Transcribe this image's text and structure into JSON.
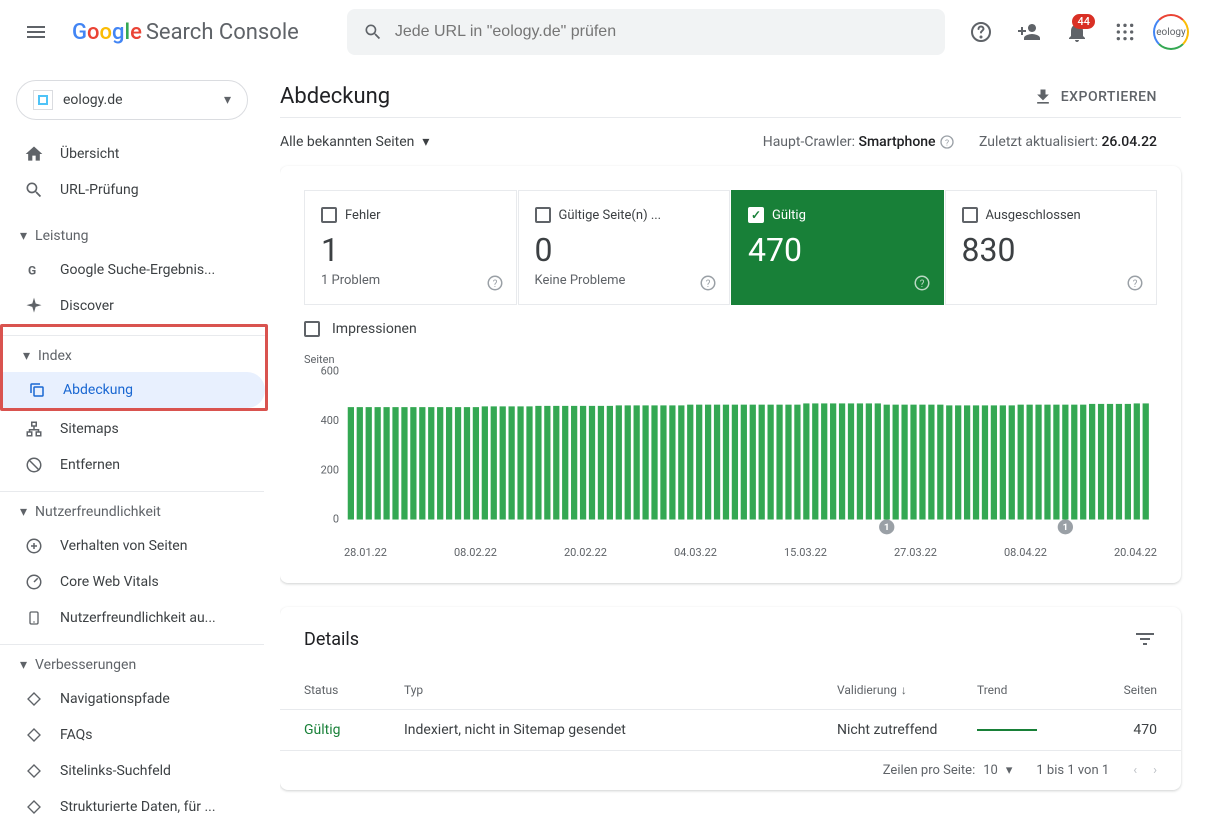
{
  "header": {
    "logo_text": "Search Console",
    "search_placeholder": "Jede URL in \"eology.de\" prüfen",
    "notification_count": "44"
  },
  "property": {
    "name": "eology.de"
  },
  "sidebar": {
    "overview": "Übersicht",
    "url_inspection": "URL-Prüfung",
    "section_performance": "Leistung",
    "search_results": "Google Suche-Ergebnis...",
    "discover": "Discover",
    "section_index": "Index",
    "coverage": "Abdeckung",
    "sitemaps": "Sitemaps",
    "removals": "Entfernen",
    "section_ux": "Nutzerfreundlichkeit",
    "page_experience": "Verhalten von Seiten",
    "core_web_vitals": "Core Web Vitals",
    "mobile_usability": "Nutzerfreundlichkeit au...",
    "section_enhancements": "Verbesserungen",
    "breadcrumbs": "Navigationspfade",
    "faqs": "FAQs",
    "sitelinks": "Sitelinks-Suchfeld",
    "structured_data": "Strukturierte Daten, für ..."
  },
  "page": {
    "title": "Abdeckung",
    "export": "EXPORTIEREN",
    "filter_label": "Alle bekannten Seiten",
    "crawler_label": "Haupt-Crawler:",
    "crawler_value": "Smartphone",
    "updated_label": "Zuletzt aktualisiert:",
    "updated_value": "26.04.22"
  },
  "status_tabs": {
    "error": {
      "label": "Fehler",
      "value": "1",
      "sub": "1 Problem"
    },
    "valid_warning": {
      "label": "Gültige Seite(n) ...",
      "value": "0",
      "sub": "Keine Probleme"
    },
    "valid": {
      "label": "Gültig",
      "value": "470"
    },
    "excluded": {
      "label": "Ausgeschlossen",
      "value": "830"
    }
  },
  "impressions_label": "Impressionen",
  "chart_data": {
    "type": "bar",
    "y_title": "Seiten",
    "ylim": [
      0,
      600
    ],
    "y_ticks": [
      "600",
      "400",
      "200",
      "0"
    ],
    "x_ticks": [
      "28.01.22",
      "08.02.22",
      "20.02.22",
      "04.03.22",
      "15.03.22",
      "27.03.22",
      "08.04.22",
      "20.04.22"
    ],
    "values": [
      455,
      455,
      455,
      455,
      455,
      455,
      455,
      455,
      455,
      455,
      455,
      455,
      455,
      455,
      455,
      458,
      458,
      458,
      458,
      458,
      458,
      460,
      460,
      460,
      460,
      460,
      460,
      460,
      460,
      460,
      462,
      462,
      462,
      462,
      462,
      462,
      462,
      462,
      465,
      465,
      465,
      465,
      465,
      465,
      465,
      465,
      465,
      465,
      465,
      465,
      465,
      470,
      470,
      470,
      470,
      470,
      470,
      470,
      470,
      470,
      465,
      465,
      465,
      465,
      465,
      465,
      465,
      462,
      462,
      462,
      462,
      462,
      462,
      462,
      462,
      465,
      465,
      465,
      465,
      465,
      465,
      465,
      465,
      468,
      468,
      468,
      468,
      468,
      470,
      470
    ],
    "markers": [
      {
        "index": 60,
        "label": "1"
      },
      {
        "index": 80,
        "label": "1"
      }
    ]
  },
  "details": {
    "title": "Details",
    "columns": {
      "status": "Status",
      "type": "Typ",
      "validation": "Validierung",
      "trend": "Trend",
      "pages": "Seiten"
    },
    "rows": [
      {
        "status": "Gültig",
        "type": "Indexiert, nicht in Sitemap gesendet",
        "validation": "Nicht zutreffend",
        "pages": "470"
      }
    ],
    "footer": {
      "rows_label": "Zeilen pro Seite:",
      "rows_value": "10",
      "range": "1 bis 1 von 1"
    }
  }
}
